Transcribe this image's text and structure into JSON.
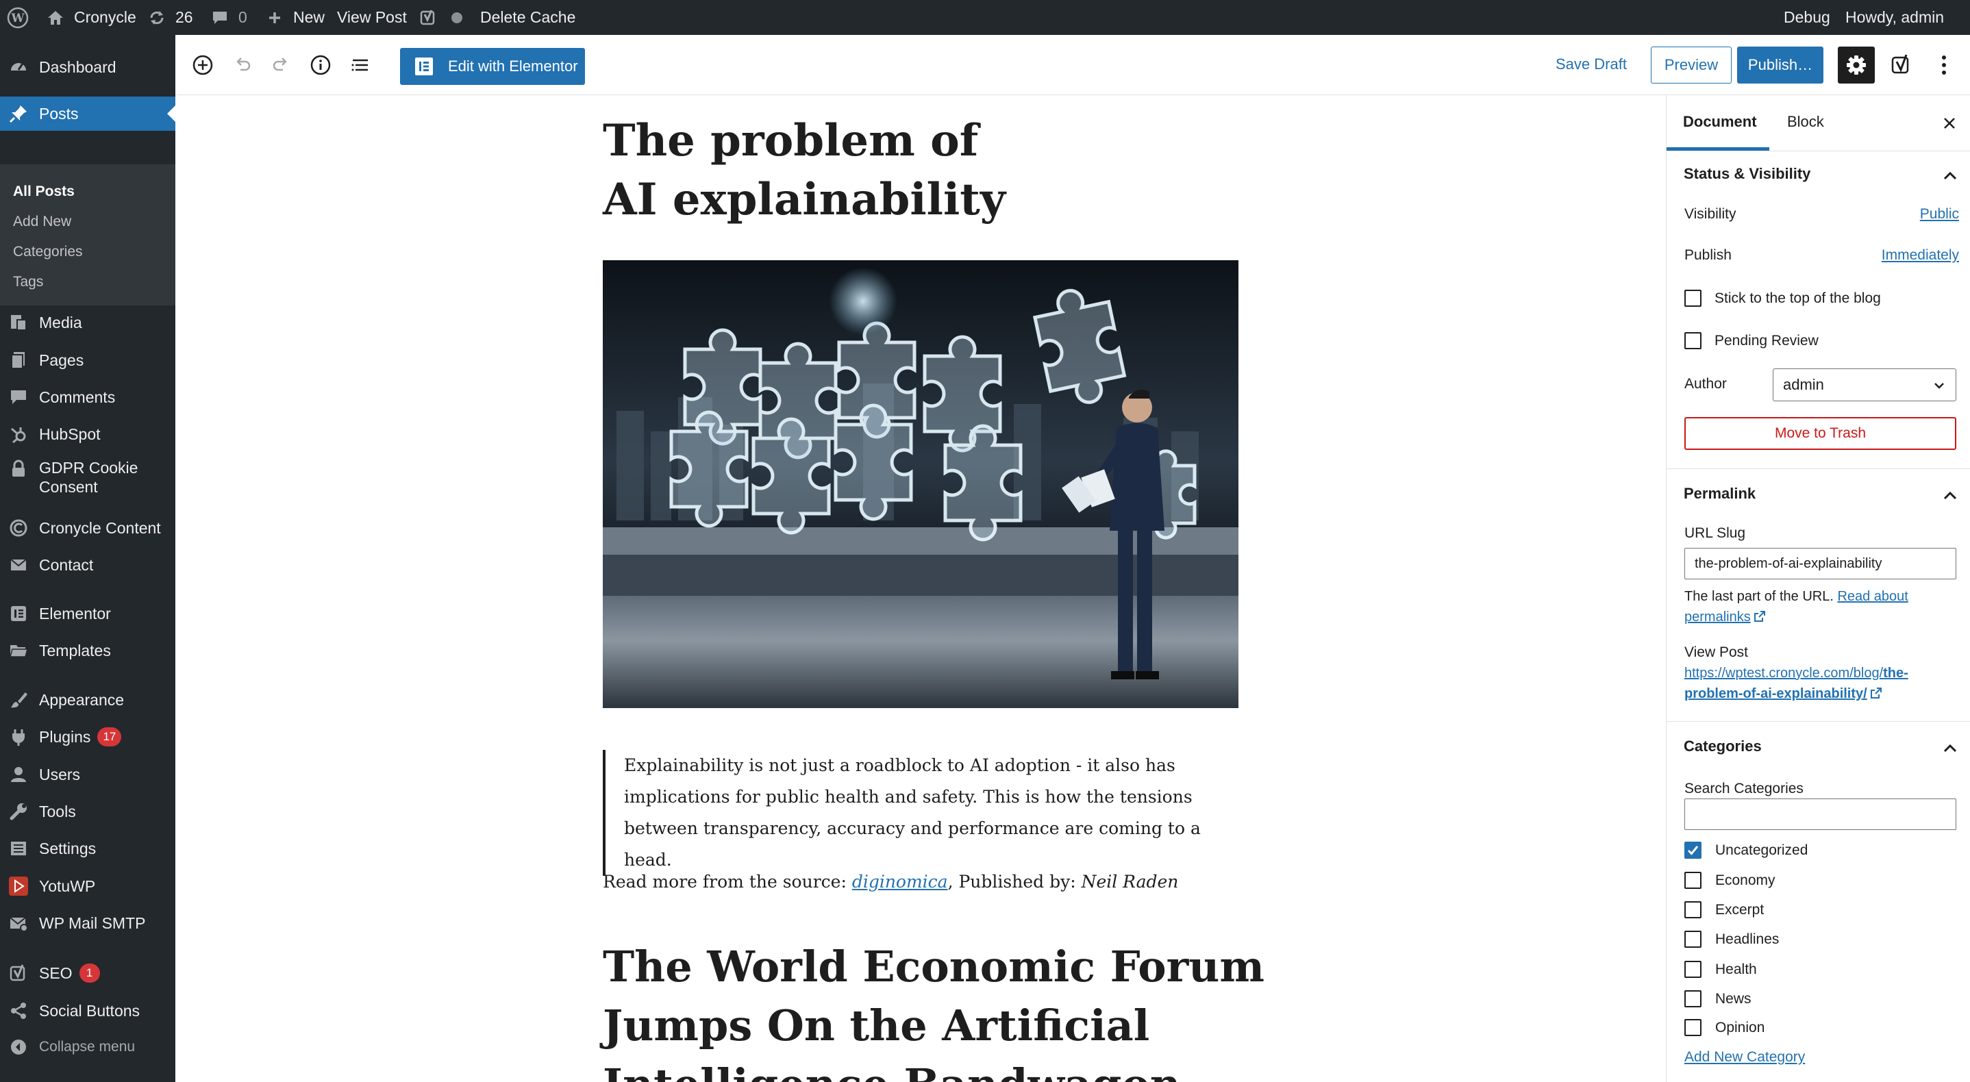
{
  "admin_bar": {
    "site_name": "Cronycle",
    "updates_count": "26",
    "comments_count": "0",
    "new_label": "New",
    "view_post_label": "View Post",
    "delete_cache_label": "Delete Cache",
    "debug_label": "Debug",
    "howdy_label": "Howdy, admin"
  },
  "menu": {
    "items": [
      {
        "label": "Dashboard",
        "icon": "dashboard-icon"
      },
      {
        "label": "Posts",
        "icon": "pushpin-icon",
        "active": true
      },
      {
        "label": "Media",
        "icon": "media-icon"
      },
      {
        "label": "Pages",
        "icon": "pages-icon"
      },
      {
        "label": "Comments",
        "icon": "comment-icon"
      },
      {
        "label": "HubSpot",
        "icon": "hubspot-icon"
      },
      {
        "label": "GDPR Cookie Consent",
        "icon": "lock-icon"
      },
      {
        "label": "Cronycle Content",
        "icon": "cronycle-icon"
      },
      {
        "label": "Contact",
        "icon": "mail-icon"
      },
      {
        "label": "Elementor",
        "icon": "elementor-icon"
      },
      {
        "label": "Templates",
        "icon": "folder-icon"
      },
      {
        "label": "Appearance",
        "icon": "brush-icon"
      },
      {
        "label": "Plugins",
        "icon": "plugin-icon",
        "badge": "17"
      },
      {
        "label": "Users",
        "icon": "user-icon"
      },
      {
        "label": "Tools",
        "icon": "wrench-icon"
      },
      {
        "label": "Settings",
        "icon": "settings-icon"
      },
      {
        "label": "YotuWP",
        "icon": "yotuwp-icon"
      },
      {
        "label": "WP Mail SMTP",
        "icon": "mail-smtp-icon"
      },
      {
        "label": "SEO",
        "icon": "yoast-icon",
        "badge": "1"
      },
      {
        "label": "Social Buttons",
        "icon": "share-icon"
      },
      {
        "label": "Collapse menu",
        "icon": "collapse-icon"
      }
    ],
    "posts_submenu": [
      "All Posts",
      "Add New",
      "Categories",
      "Tags"
    ]
  },
  "toolbar": {
    "edit_elementor_label": "Edit with Elementor",
    "save_draft_label": "Save Draft",
    "preview_label": "Preview",
    "publish_label": "Publish…"
  },
  "post": {
    "title": "The problem of AI explainability",
    "quote": "Explainability is not just a roadblock to AI adoption - it also has implications for public health and safety. This is how the tensions between transparency, accuracy and performance are coming to a head.",
    "source_prefix": "Read more from the source: ",
    "source_link": "diginomica",
    "source_mid": ", Published by: ",
    "source_author": "Neil Raden",
    "subheading": "The World Economic Forum Jumps On the Artificial Intelligence Bandwagon"
  },
  "sidebar": {
    "tab_document": "Document",
    "tab_block": "Block",
    "status": {
      "heading": "Status & Visibility",
      "visibility_label": "Visibility",
      "visibility_value": "Public",
      "publish_label": "Publish",
      "publish_value": "Immediately",
      "stick_label": "Stick to the top of the blog",
      "pending_label": "Pending Review",
      "author_label": "Author",
      "author_value": "admin",
      "trash_label": "Move to Trash"
    },
    "permalink": {
      "heading": "Permalink",
      "slug_label": "URL Slug",
      "slug_value": "the-problem-of-ai-explainability",
      "help_prefix": "The last part of the URL. ",
      "help_link": "Read about permalinks",
      "view_post_label": "View Post",
      "url_prefix": "https://wptest.cronycle.com/blog/",
      "url_slug": "the-problem-of-ai-explainability/"
    },
    "categories": {
      "heading": "Categories",
      "search_label": "Search Categories",
      "search_value": "",
      "items": [
        {
          "label": "Uncategorized",
          "checked": true
        },
        {
          "label": "Economy",
          "checked": false
        },
        {
          "label": "Excerpt",
          "checked": false
        },
        {
          "label": "Headlines",
          "checked": false
        },
        {
          "label": "Health",
          "checked": false
        },
        {
          "label": "News",
          "checked": false
        },
        {
          "label": "Opinion",
          "checked": false
        }
      ],
      "add_new_label": "Add New Category"
    }
  },
  "colors": {
    "admin_dark": "#23282d",
    "accent_blue": "#2271b1",
    "badge_red": "#d63638",
    "trash_red": "#cc1818"
  }
}
